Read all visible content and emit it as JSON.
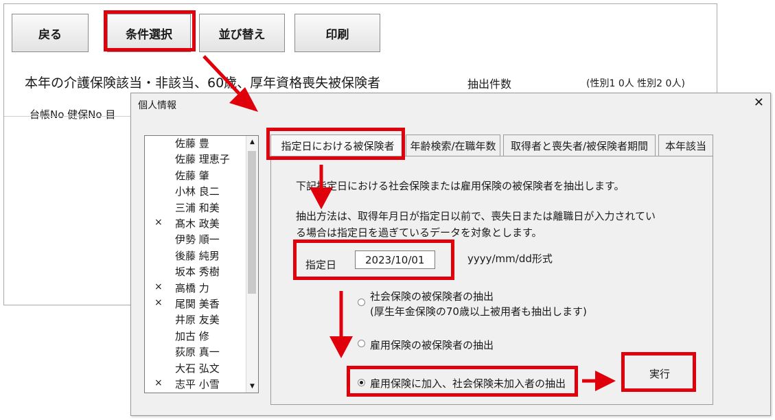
{
  "toolbar": {
    "back_label": "戻る",
    "condition_label": "条件選択",
    "sort_label": "並び替え",
    "print_label": "印刷"
  },
  "sheet": {
    "title": "本年の介護保険該当・非該当、60歳、厚年資格喪失被保険者",
    "count_label": "抽出件数",
    "count_detail": "(性別1 0人 性別2 0人)",
    "columns": "台帳No 健保No 目"
  },
  "dialog": {
    "title": "個人情報",
    "close_icon": "close-icon"
  },
  "people": [
    {
      "mark": "",
      "name": "佐藤 豊"
    },
    {
      "mark": "",
      "name": "佐藤 理恵子"
    },
    {
      "mark": "",
      "name": "佐藤 肇"
    },
    {
      "mark": "",
      "name": "小林 良二"
    },
    {
      "mark": "",
      "name": "三浦 和美"
    },
    {
      "mark": "×",
      "name": "髙木 政美"
    },
    {
      "mark": "",
      "name": "伊勢 順一"
    },
    {
      "mark": "",
      "name": "後藤 純男"
    },
    {
      "mark": "",
      "name": "坂本 秀樹"
    },
    {
      "mark": "×",
      "name": "高橋 力"
    },
    {
      "mark": "×",
      "name": "尾関 美香"
    },
    {
      "mark": "",
      "name": "井原 友美"
    },
    {
      "mark": "",
      "name": "加古 修"
    },
    {
      "mark": "",
      "name": "荻原 真一"
    },
    {
      "mark": "",
      "name": "大石 弘文"
    },
    {
      "mark": "×",
      "name": "志平 小雪"
    }
  ],
  "tabs": [
    {
      "label": "指定日における被保険者",
      "selected": true
    },
    {
      "label": "年齢検索/在職年数",
      "selected": false
    },
    {
      "label": "取得者と喪失者/被保険者期間",
      "selected": false
    },
    {
      "label": "本年該当",
      "selected": false
    }
  ],
  "panel": {
    "desc1": "下記指定日における社会保険または雇用保険の被保険者を抽出します。",
    "desc2": "抽出方法は、取得年月日が指定日以前で、喪失日または離職日が入力されてい",
    "desc3": "る場合は指定日を過ぎているデータを対象とします。",
    "date_label": "指定日",
    "date_value": "2023/10/01",
    "date_format": "yyyy/mm/dd形式",
    "option1_line1": "社会保険の被保険者の抽出",
    "option1_line2": "(厚生年金保険の70歳以上被用者も抽出します)",
    "option2": "雇用保険の被保険者の抽出",
    "option3": "雇用保険に加入、社会保険未加入者の抽出",
    "selected_option": 3,
    "execute_label": "実行"
  },
  "colors": {
    "highlight": "#e0000b"
  }
}
